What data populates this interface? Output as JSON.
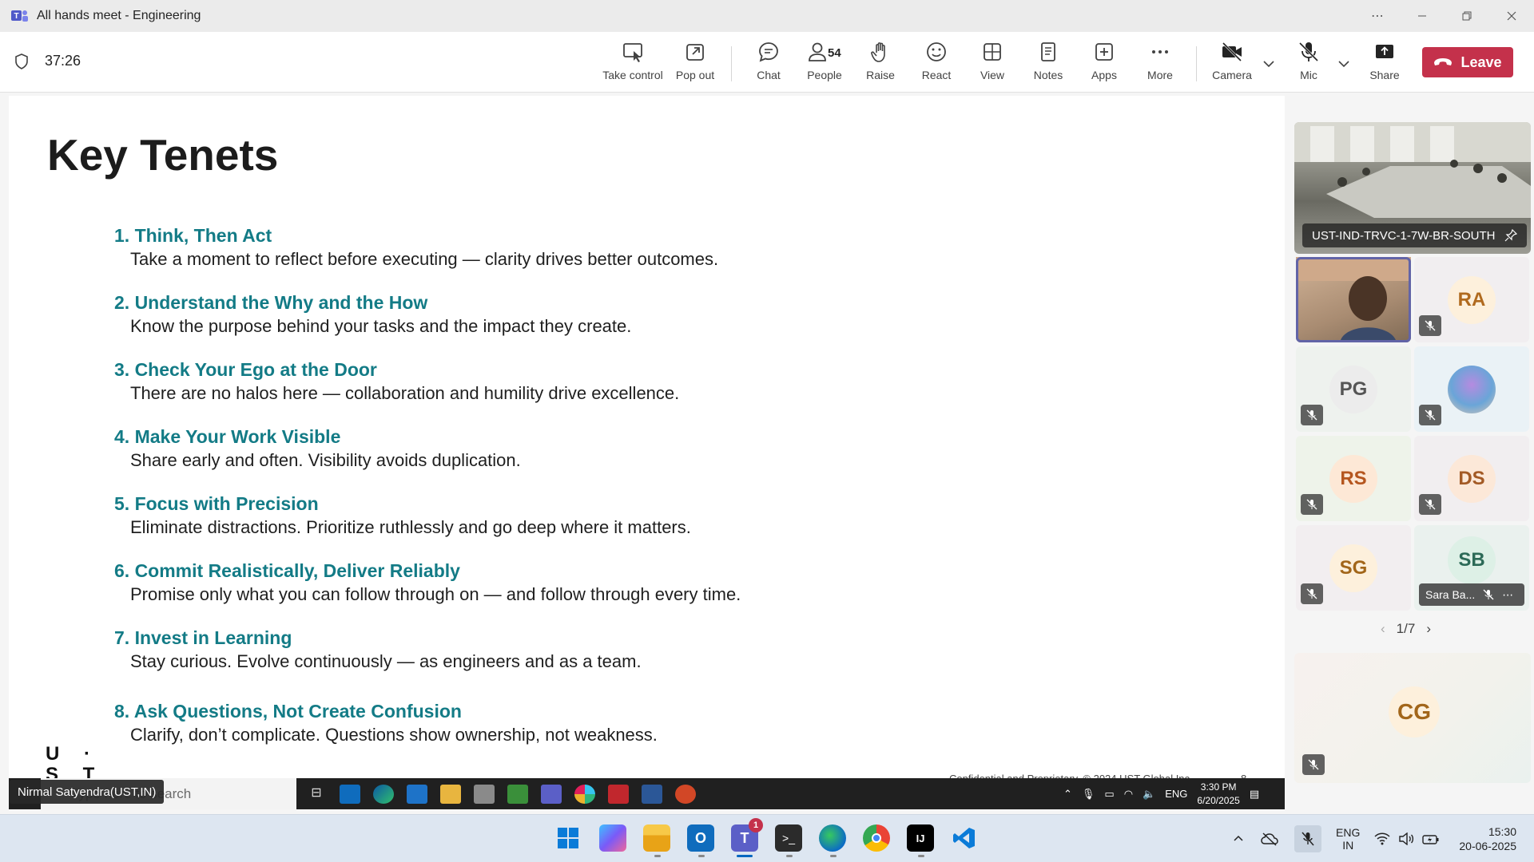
{
  "window": {
    "title": "All hands meet - Engineering"
  },
  "meeting": {
    "timer": "37:26",
    "people_count": "54",
    "toolbar": [
      {
        "id": "take-control",
        "label": "Take control"
      },
      {
        "id": "pop-out",
        "label": "Pop out"
      },
      {
        "id": "chat",
        "label": "Chat"
      },
      {
        "id": "people",
        "label": "People"
      },
      {
        "id": "raise",
        "label": "Raise"
      },
      {
        "id": "react",
        "label": "React"
      },
      {
        "id": "view",
        "label": "View"
      },
      {
        "id": "notes",
        "label": "Notes"
      },
      {
        "id": "apps",
        "label": "Apps"
      },
      {
        "id": "more",
        "label": "More"
      },
      {
        "id": "camera",
        "label": "Camera"
      },
      {
        "id": "mic",
        "label": "Mic"
      },
      {
        "id": "share",
        "label": "Share"
      }
    ],
    "leave_label": "Leave"
  },
  "slide": {
    "title": "Key Tenets",
    "tenets": [
      {
        "heading": "1. Think, Then Act",
        "body": "Take a moment to reflect before executing — clarity drives better outcomes."
      },
      {
        "heading": "2. Understand the Why and the How",
        "body": "Know the purpose behind your tasks and the impact they create."
      },
      {
        "heading": "3. Check Your Ego at the Door",
        "body": "There are no halos here — collaboration and humility drive excellence."
      },
      {
        "heading": "4. Make Your Work Visible",
        "body": "Share early and often. Visibility avoids duplication."
      },
      {
        "heading": "5. Focus with Precision",
        "body": "Eliminate distractions. Prioritize ruthlessly and go deep where it matters."
      },
      {
        "heading": "6. Commit Realistically, Deliver Reliably",
        "body": "Promise only what you can follow through on — and follow through every time."
      },
      {
        "heading": "7. Invest in Learning",
        "body": "Stay curious. Evolve continuously — as engineers and as a team."
      },
      {
        "heading": "8. Ask Questions, Not Create Confusion",
        "body": "Clarify, don’t complicate. Questions show ownership, not weakness."
      }
    ],
    "logo_line1": "U ·",
    "logo_line2": "S T",
    "footer": "Confidential and Proprietary. © 2024 UST Global Inc.",
    "page_number": "8"
  },
  "presenter_screen": {
    "presenter_name": "Nirmal Satyendra(UST,IN)",
    "search_placeholder": "Type here to search",
    "tray_lang": "ENG",
    "time": "3:30 PM",
    "date": "6/20/2025"
  },
  "participants": {
    "room_name": "UST-IND-TRVC-1-7W-BR-SOUTH",
    "tiles": [
      {
        "initials": "",
        "type": "video"
      },
      {
        "initials": "RA",
        "color": "#b06a1e",
        "bg": "#fdf0dc"
      },
      {
        "initials": "PG",
        "color": "#555555",
        "bg": "#ececec"
      },
      {
        "initials": "",
        "type": "photo"
      },
      {
        "initials": "RS",
        "color": "#b5561f",
        "bg": "#fde8d6"
      },
      {
        "initials": "DS",
        "color": "#a35a25",
        "bg": "#fce8d8"
      },
      {
        "initials": "SG",
        "color": "#a2661a",
        "bg": "#fdf0dc"
      },
      {
        "initials": "SB",
        "color": "#2c6a57",
        "bg": "#ddf0e6",
        "name": "Sara Ba..."
      }
    ],
    "pager": "1/7",
    "spotlight_initials": "CG"
  },
  "taskbar": {
    "teams_badge": "1",
    "lang_line1": "ENG",
    "lang_line2": "IN",
    "time": "15:30",
    "date": "20-06-2025"
  },
  "colors": {
    "accent": "#6264a7",
    "leave": "#c4314b",
    "tenet_heading": "#137b86"
  }
}
